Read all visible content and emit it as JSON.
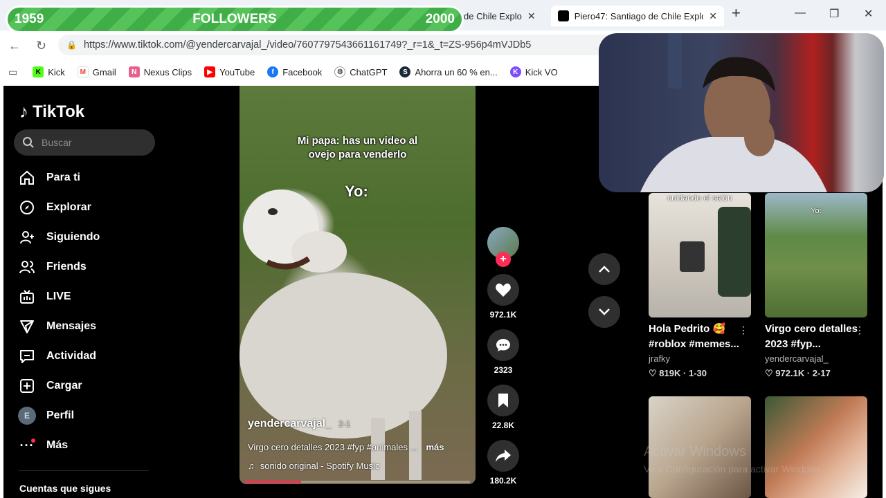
{
  "browser": {
    "tabs": [
      {
        "title": "de Chile Explo"
      },
      {
        "title": "Piero47: Santiago de Chile Explo"
      }
    ],
    "url": "https://www.tiktok.com/@yendercarvajal_/video/7607797543661161749?_r=1&_t=ZS-956p4mVJDb5",
    "bookmarks": [
      {
        "label": "Kick",
        "icon": "kick-icon",
        "color": "#53fc18"
      },
      {
        "label": "Gmail",
        "icon": "gmail-icon",
        "color": "#ea4335"
      },
      {
        "label": "Nexus Clips",
        "icon": "nexus-icon",
        "color": "#e8618c"
      },
      {
        "label": "YouTube",
        "icon": "youtube-icon",
        "color": "#ff0000"
      },
      {
        "label": "Facebook",
        "icon": "facebook-icon",
        "color": "#1877f2"
      },
      {
        "label": "ChatGPT",
        "icon": "chatgpt-icon",
        "color": "#444444"
      },
      {
        "label": "Ahorra un 60 % en...",
        "icon": "steam-icon",
        "color": "#1b2838"
      },
      {
        "label": "Kick VO",
        "icon": "kickvo-icon",
        "color": "#7c4dff"
      }
    ]
  },
  "followers_goal": {
    "current": "1959",
    "label": "FOLLOWERS",
    "target": "2000"
  },
  "tiktok": {
    "brand": "TikTok",
    "search_placeholder": "Buscar",
    "menu": [
      {
        "label": "Para ti",
        "icon": "home-icon"
      },
      {
        "label": "Explorar",
        "icon": "compass-icon"
      },
      {
        "label": "Siguiendo",
        "icon": "user-follow-icon"
      },
      {
        "label": "Friends",
        "icon": "friends-icon"
      },
      {
        "label": "LIVE",
        "icon": "live-icon"
      },
      {
        "label": "Mensajes",
        "icon": "send-icon"
      },
      {
        "label": "Actividad",
        "icon": "activity-icon"
      },
      {
        "label": "Cargar",
        "icon": "upload-icon"
      },
      {
        "label": "Perfil",
        "icon": "profile-avatar",
        "avatar_letter": "E"
      },
      {
        "label": "Más",
        "icon": "more-icon"
      }
    ],
    "following_title": "Cuentas que sigues",
    "video": {
      "caption_top": "Mi papa: has un video al ovejo para venderlo",
      "caption_yo": "Yo:",
      "author": "yendercarvajal_",
      "author_date": "2-1",
      "description": "Virgo cero detalles 2023 #fyp #animales ...",
      "more": "más",
      "sound": "sonido original - Spotify Music",
      "progress": 0.25
    },
    "actions": {
      "likes": "972.1K",
      "comments": "2323",
      "saves": "22.8K",
      "shares": "180.2K"
    },
    "recommended": [
      {
        "overlay": "cuidando el salón",
        "title": "Hola Pedrito 🥰 #roblox #memes...",
        "user": "jrafky",
        "likes": "819K",
        "date": "1-30"
      },
      {
        "overlay": "Yo:",
        "title": "Virgo cero detalles 2023 #fyp...",
        "user": "yendercarvajal_",
        "likes": "972.1K",
        "date": "2-17"
      },
      {
        "overlay": "",
        "title": "",
        "user": "",
        "likes": "",
        "date": ""
      },
      {
        "overlay": "",
        "title": "",
        "user": "",
        "likes": "",
        "date": ""
      }
    ],
    "watermark_line1": "Activar Windows",
    "watermark_line2": "Ve a Configuración para activar Windows."
  }
}
